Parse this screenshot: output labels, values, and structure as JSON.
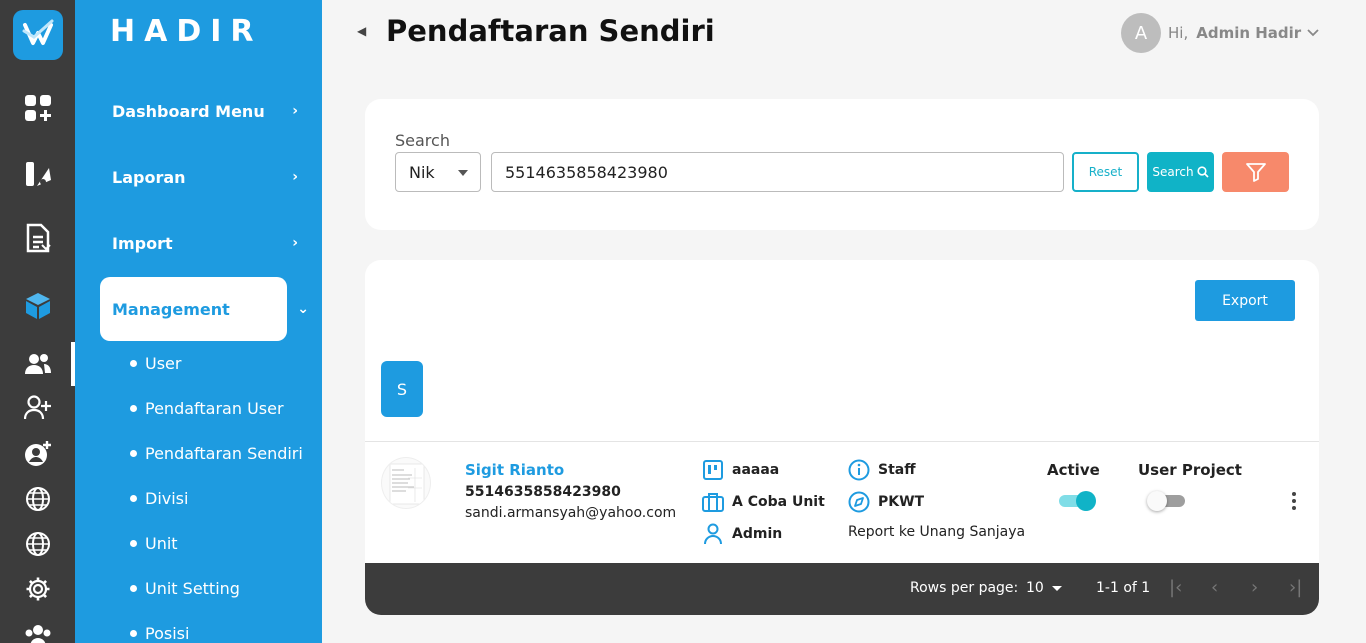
{
  "app": {
    "brand": "HADIR"
  },
  "sidebar": {
    "menu": [
      {
        "label": "Dashboard Menu"
      },
      {
        "label": "Laporan"
      },
      {
        "label": "Import"
      },
      {
        "label": "Management"
      }
    ],
    "submenu": [
      {
        "label": "User"
      },
      {
        "label": "Pendaftaran User"
      },
      {
        "label": "Pendaftaran Sendiri"
      },
      {
        "label": "Divisi"
      },
      {
        "label": "Unit"
      },
      {
        "label": "Unit Setting"
      },
      {
        "label": "Posisi"
      }
    ]
  },
  "header": {
    "title": "Pendaftaran Sendiri",
    "avatar_letter": "A",
    "greeting": "Hi,",
    "user_name": "Admin Hadir"
  },
  "search": {
    "label": "Search",
    "field": "Nik",
    "value": "5514635858423980",
    "reset_label": "Reset",
    "search_label": "Search"
  },
  "table": {
    "export_label": "Export",
    "group_letter": "S",
    "rows": [
      {
        "name": "Sigit Rianto",
        "nik": "5514635858423980",
        "email": "sandi.armansyah@yahoo.com",
        "division": "aaaaa",
        "unit": "A Coba Unit",
        "role": "Admin",
        "position": "Staff",
        "contract": "PKWT",
        "report": "Report ke Unang Sanjaya",
        "active_label": "Active",
        "active": true,
        "user_project_label": "User Project",
        "user_project": false
      }
    ],
    "footer": {
      "rows_per_page_label": "Rows per page:",
      "rows_per_page": "10",
      "range": "1-1 of 1"
    }
  },
  "colors": {
    "primary": "#1e9be0",
    "teal": "#10b3c7",
    "orange": "#f7896b",
    "dark": "#3c3c3c"
  }
}
